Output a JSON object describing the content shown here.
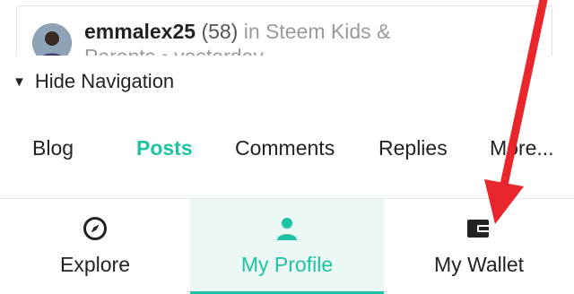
{
  "post": {
    "author": "emmalex25",
    "reputation": "(58)",
    "in_text": "in Steem Kids &",
    "line2": "Parents • yesterday"
  },
  "navigation": {
    "hide_label": "Hide Navigation",
    "tabs": [
      {
        "label": "Blog"
      },
      {
        "label": "Posts"
      },
      {
        "label": "Comments"
      },
      {
        "label": "Replies"
      },
      {
        "label": "More..."
      }
    ],
    "active_tab": "Posts"
  },
  "bottom_bar": {
    "items": [
      {
        "label": "Explore",
        "icon": "compass-icon"
      },
      {
        "label": "My Profile",
        "icon": "person-icon"
      },
      {
        "label": "My Wallet",
        "icon": "wallet-icon"
      }
    ],
    "active": "My Profile"
  },
  "colors": {
    "accent": "#1fc3a3",
    "active_bg": "#ecf8f3",
    "annotation": "#e8262b"
  }
}
